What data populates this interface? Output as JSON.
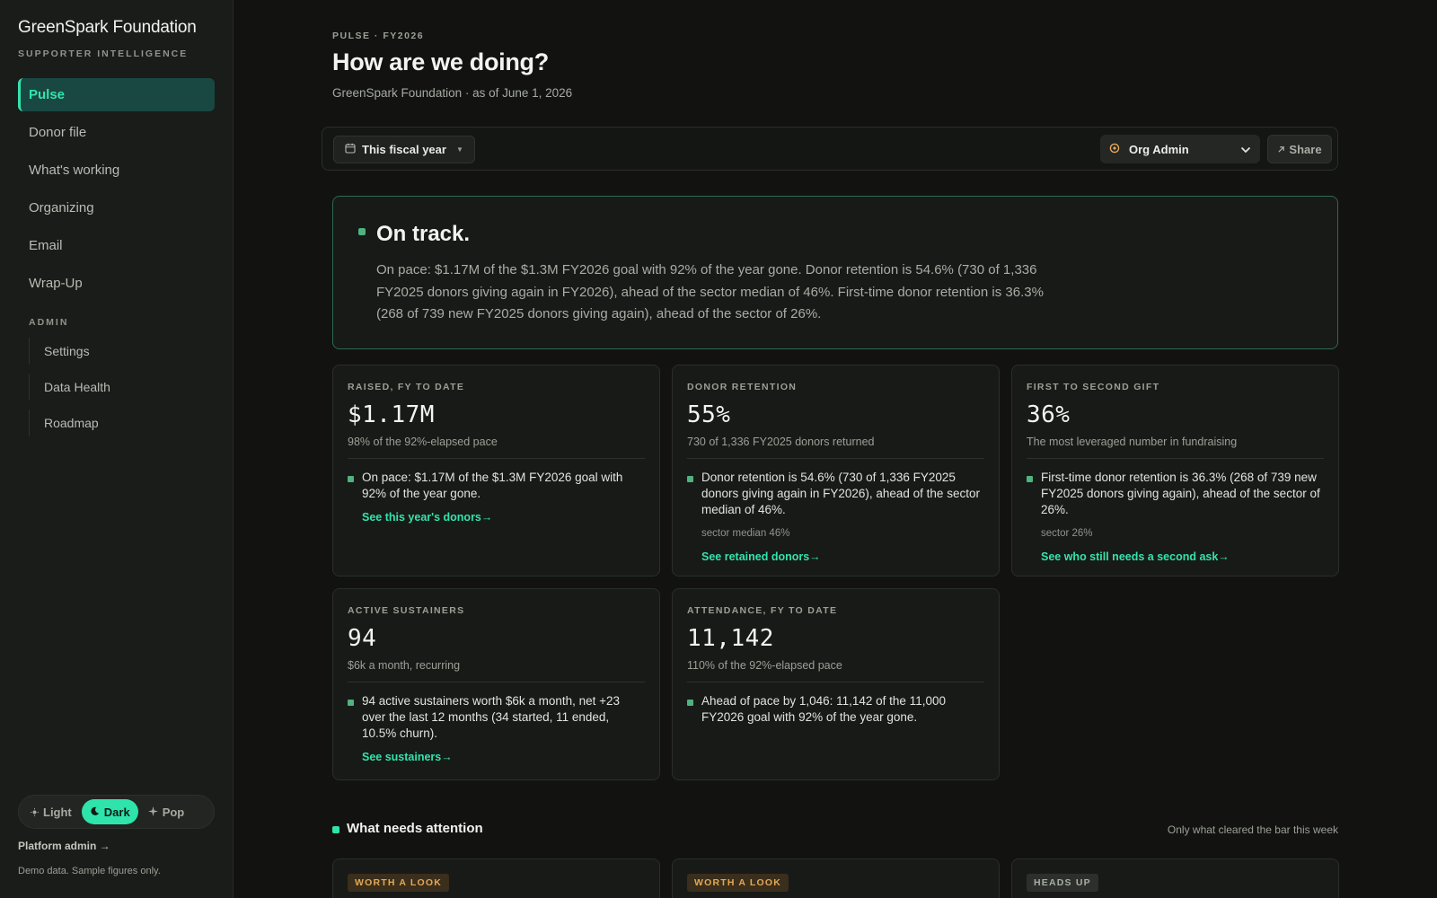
{
  "brand": {
    "name": "GreenSpark Foundation",
    "subtitle": "SUPPORTER INTELLIGENCE"
  },
  "nav": [
    {
      "label": "Pulse",
      "active": true
    },
    {
      "label": "Donor file"
    },
    {
      "label": "What's working"
    },
    {
      "label": "Organizing"
    },
    {
      "label": "Email"
    },
    {
      "label": "Wrap-Up"
    }
  ],
  "admin": {
    "label": "ADMIN",
    "items": [
      "Settings",
      "Data Health",
      "Roadmap"
    ]
  },
  "theme": {
    "options": [
      "Light",
      "Dark",
      "Pop"
    ],
    "selected": "Dark"
  },
  "footer": {
    "platform_admin": "Platform admin →",
    "demo_note": "Demo data. Sample figures only."
  },
  "header": {
    "eyebrow": "PULSE · FY2026",
    "title": "How are we doing?",
    "subtitle": "GreenSpark Foundation · as of June 1, 2026"
  },
  "toolbar": {
    "period": "This fiscal year",
    "role": "Org Admin",
    "share": "Share"
  },
  "hero": {
    "title": "On track.",
    "text": "On pace: $1.17M of the $1.3M FY2026 goal with 92% of the year gone. Donor retention is 54.6% (730 of 1,336 FY2025 donors giving again in FY2026), ahead of the sector median of 46%. First-time donor retention is 36.3% (268 of 739 new FY2025 donors giving again), ahead of the sector of 26%."
  },
  "cards": [
    {
      "label": "RAISED, FY TO DATE",
      "value": "$1.17M",
      "caption": "98% of the 92%-elapsed pace",
      "text": "On pace: $1.17M of the $1.3M FY2026 goal with 92% of the year gone.",
      "note": "",
      "link": "See this year's donors→"
    },
    {
      "label": "DONOR RETENTION",
      "value": "55%",
      "caption": "730 of 1,336 FY2025 donors returned",
      "text": "Donor retention is 54.6% (730 of 1,336 FY2025 donors giving again in FY2026), ahead of the sector median of 46%.",
      "note": "sector median 46%",
      "link": "See retained donors→"
    },
    {
      "label": "FIRST TO SECOND GIFT",
      "value": "36%",
      "caption": "The most leveraged number in fundraising",
      "text": "First-time donor retention is 36.3% (268 of 739 new FY2025 donors giving again), ahead of the sector of 26%.",
      "note": "sector 26%",
      "link": "See who still needs a second ask→"
    },
    {
      "label": "ACTIVE SUSTAINERS",
      "value": "94",
      "caption": "$6k a month, recurring",
      "text": "94 active sustainers worth $6k a month, net +23 over the last 12 months (34 started, 11 ended, 10.5% churn).",
      "note": "",
      "link": "See sustainers→"
    },
    {
      "label": "ATTENDANCE, FY TO DATE",
      "value": "11,142",
      "caption": "110% of the 92%-elapsed pace",
      "text": "Ahead of pace by 1,046: 11,142 of the 11,000 FY2026 goal with 92% of the year gone.",
      "note": "",
      "link": ""
    }
  ],
  "attention": {
    "title": "What needs attention",
    "note": "Only what cleared the bar this week",
    "badges": [
      "WORTH A LOOK",
      "WORTH A LOOK",
      "HEADS UP"
    ]
  },
  "colors": {
    "accent": "#33e3ad",
    "ok": "#4fb27f",
    "warn": "#e3a857",
    "background": "#121311"
  }
}
